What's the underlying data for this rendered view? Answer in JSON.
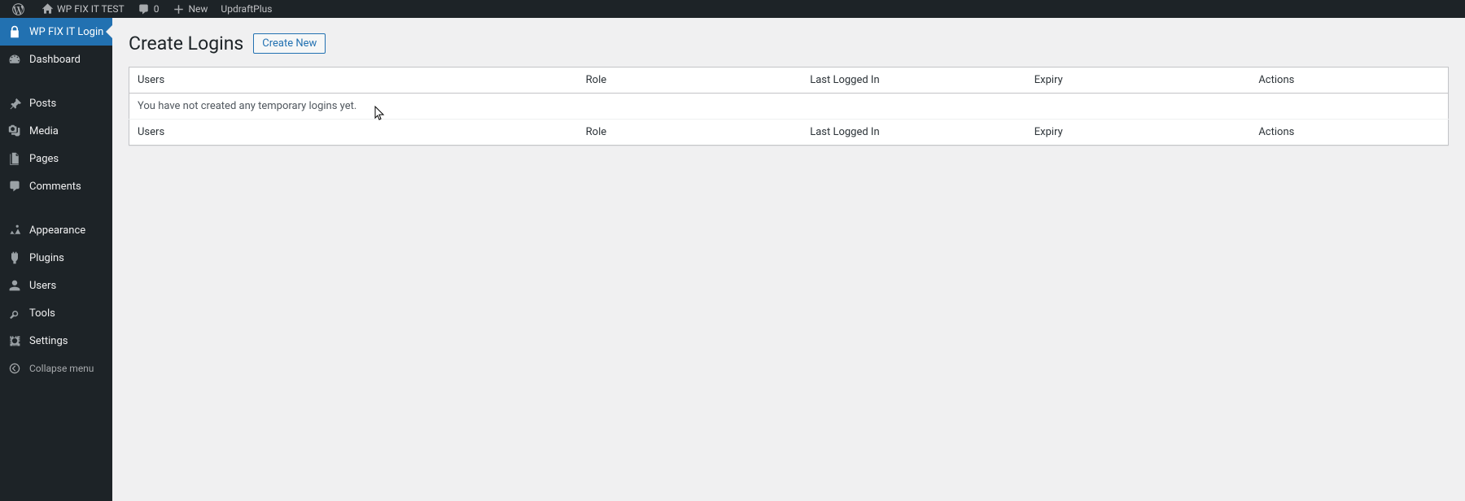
{
  "adminbar": {
    "site_name": "WP FIX IT TEST",
    "comments_count": "0",
    "new_label": "New",
    "updraft_label": "UpdraftPlus"
  },
  "sidebar": {
    "items": [
      {
        "label": "WP FIX IT Login"
      },
      {
        "label": "Dashboard"
      },
      {
        "label": "Posts"
      },
      {
        "label": "Media"
      },
      {
        "label": "Pages"
      },
      {
        "label": "Comments"
      },
      {
        "label": "Appearance"
      },
      {
        "label": "Plugins"
      },
      {
        "label": "Users"
      },
      {
        "label": "Tools"
      },
      {
        "label": "Settings"
      },
      {
        "label": "Collapse menu"
      }
    ]
  },
  "page": {
    "title": "Create Logins",
    "action_label": "Create New"
  },
  "table": {
    "cols": {
      "users": "Users",
      "role": "Role",
      "last": "Last Logged In",
      "expiry": "Expiry",
      "actions": "Actions"
    },
    "empty_message": "You have not created any temporary logins yet."
  }
}
